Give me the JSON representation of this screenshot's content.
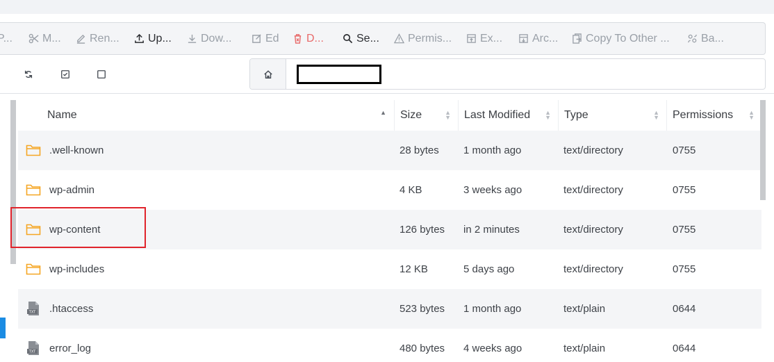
{
  "toolbar": {
    "items": [
      {
        "label": "P...",
        "icon": "partial-icon",
        "state": "disabled"
      },
      {
        "label": "M...",
        "icon": "scissors-icon",
        "state": "disabled"
      },
      {
        "label": "Ren...",
        "icon": "pencil-icon",
        "state": "disabled"
      },
      {
        "label": "Up...",
        "icon": "upload-icon",
        "state": "enabled"
      },
      {
        "label": "Dow...",
        "icon": "download-icon",
        "state": "disabled"
      },
      {
        "label": "Ed",
        "icon": "edit-icon",
        "state": "disabled"
      },
      {
        "label": "D...",
        "icon": "trash-icon",
        "state": "danger"
      },
      {
        "label": "Se...",
        "icon": "search-icon",
        "state": "enabled"
      },
      {
        "label": "Permis...",
        "icon": "warning-icon",
        "state": "disabled"
      },
      {
        "label": "Ex...",
        "icon": "extract-icon",
        "state": "disabled"
      },
      {
        "label": "Arc...",
        "icon": "archive-icon",
        "state": "disabled"
      },
      {
        "label": "Copy To Other ...",
        "icon": "copy-to-icon",
        "state": "disabled"
      },
      {
        "label": "Ba...",
        "icon": "backup-icon",
        "state": "disabled"
      }
    ]
  },
  "nav": {
    "icons": [
      "refresh-icon",
      "select-all-icon",
      "deselect-icon"
    ],
    "home_icon": "home-icon"
  },
  "table": {
    "columns": [
      "Name",
      "Size",
      "Last Modified",
      "Type",
      "Permissions"
    ],
    "rows": [
      {
        "icon": "folder-icon",
        "name": ".well-known",
        "size": "28 bytes",
        "modified": "1 month ago",
        "type": "text/directory",
        "perm": "0755"
      },
      {
        "icon": "folder-icon",
        "name": "wp-admin",
        "size": "4 KB",
        "modified": "3 weeks ago",
        "type": "text/directory",
        "perm": "0755"
      },
      {
        "icon": "folder-icon",
        "name": "wp-content",
        "size": "126 bytes",
        "modified": "in 2 minutes",
        "type": "text/directory",
        "perm": "0755"
      },
      {
        "icon": "folder-icon",
        "name": "wp-includes",
        "size": "12 KB",
        "modified": "5 days ago",
        "type": "text/directory",
        "perm": "0755"
      },
      {
        "icon": "txt-file-icon",
        "name": ".htaccess",
        "size": "523 bytes",
        "modified": "1 month ago",
        "type": "text/plain",
        "perm": "0644"
      },
      {
        "icon": "txt-file-icon",
        "name": "error_log",
        "size": "480 bytes",
        "modified": "4 weeks ago",
        "type": "text/plain",
        "perm": "0644"
      }
    ]
  },
  "colors": {
    "folder": "#f5a623",
    "danger": "#e86a6a",
    "highlight": "#e0232b",
    "accent": "#1b8ce3"
  }
}
